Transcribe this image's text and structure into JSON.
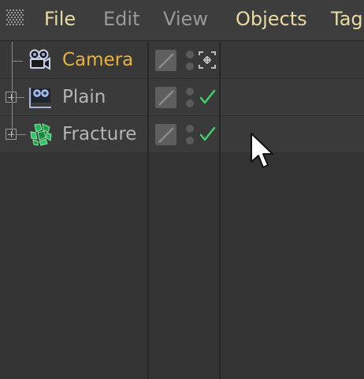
{
  "menu": {
    "items": [
      {
        "label": "File",
        "state": "active"
      },
      {
        "label": "Edit",
        "state": "dim"
      },
      {
        "label": "View",
        "state": "dim"
      },
      {
        "label": "Objects",
        "state": "active"
      },
      {
        "label": "Tag",
        "state": "active"
      }
    ]
  },
  "objects": [
    {
      "name": "Camera",
      "selected": true,
      "icon": "camera-icon",
      "expandable": false,
      "tag": "camera-target-icon"
    },
    {
      "name": "Plain",
      "selected": false,
      "icon": "plain-effector-icon",
      "expandable": true,
      "tag": "checkmark-icon"
    },
    {
      "name": "Fracture",
      "selected": false,
      "icon": "fracture-icon",
      "expandable": true,
      "tag": "checkmark-icon"
    }
  ],
  "colors": {
    "background": "#333333",
    "menu_active": "#e8dca4",
    "menu_dim": "#9a9a9a",
    "selected_object": "#e8b23c",
    "object_text": "#b5b5b5",
    "check": "#3ed16a"
  }
}
